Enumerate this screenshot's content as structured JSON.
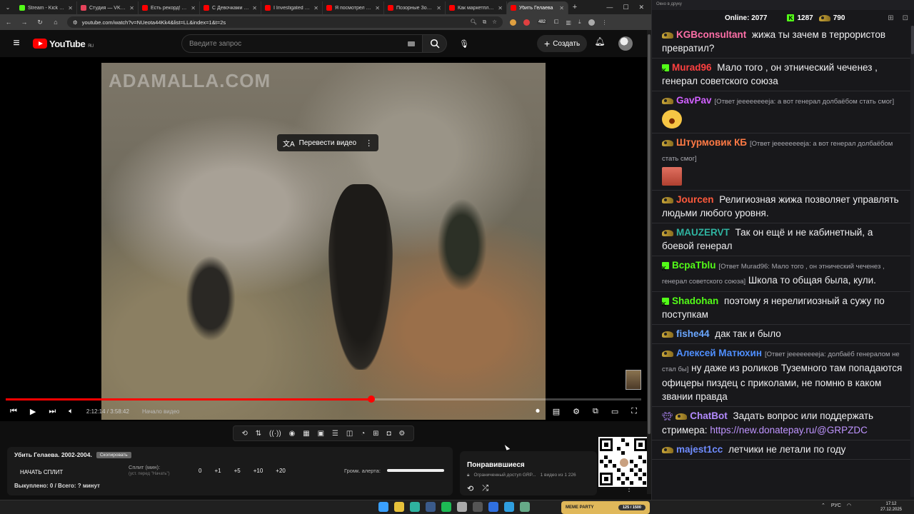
{
  "browser": {
    "tabs": [
      {
        "title": "Stream - Kick Dash",
        "color": "#53fc18"
      },
      {
        "title": "Студия — VK Видео",
        "color": "#e5435b"
      },
      {
        "title": "Есть рекорд! Пер",
        "color": "#ff0000"
      },
      {
        "title": "С Девочками Бол",
        "color": "#ff0000"
      },
      {
        "title": "I Investigated Min",
        "color": "#ff0000"
      },
      {
        "title": "Я посмотрел все ф",
        "color": "#ff0000"
      },
      {
        "title": "Позорные Зоозащ",
        "color": "#ff0000"
      },
      {
        "title": "Как маркетплейсы",
        "color": "#ff0000"
      },
      {
        "title": "Убить Гелаева",
        "color": "#ff0000",
        "active": true
      }
    ],
    "url": "youtube.com/watch?v=NUeota44Kk4&list=LL&index=1&t=2s",
    "ext_badge": "482"
  },
  "youtube": {
    "logo_text": "YouTube",
    "region": "RU",
    "search_placeholder": "Введите запрос",
    "create_label": "Создать"
  },
  "player": {
    "watermark": "ADAMALLA.COM",
    "translate_label": "Перевести видео",
    "time": "2:12:14 / 3:58:42",
    "chapter": "Начало видео",
    "progress_fraction": 0.575
  },
  "split_panel": {
    "title": "Убить Гелаева. 2002-2004.",
    "badge": "Скопировать",
    "start_label": "НАЧАТЬ СПЛИТ",
    "split_label": "Сплит (мин):",
    "split_sub": "(уст. перед \"Начать\")",
    "values": [
      "0",
      "+1",
      "+5",
      "+10",
      "+20"
    ],
    "alert_label": "Громк. алерта:",
    "status": "Выкуплено: 0 / Всего: ? минут"
  },
  "liked": {
    "title": "Понравившиеся",
    "access": "Ограниченный доступ GRP...",
    "count": "1 видео из 1 226"
  },
  "chat": {
    "topbar": "Окно в друку",
    "online_label": "Online:",
    "online_value": "2077",
    "kick_value": "1287",
    "crown_value": "790",
    "messages": [
      {
        "user": "KGBconsultant",
        "color": "#ff6fa8",
        "badge": "crown",
        "reply": "",
        "text": "жижа ты зачем в террористов превратил?"
      },
      {
        "user": "Murad96",
        "color": "#ff4040",
        "badge": "kick",
        "reply": "",
        "text": "Мало того , он этнический чеченез , генерал советского союза"
      },
      {
        "user": "GavPav",
        "color": "#d060ff",
        "badge": "crown",
        "reply": "[Ответ jeeeeeeeeja: а вот генерал долбаёбом стать смог]",
        "text": "",
        "emote": "laugh"
      },
      {
        "user": "Штурмовик КБ",
        "color": "#ff7a45",
        "badge": "crown",
        "reply": "[Ответ jeeeeeeeeja: а вот генерал долбаёбом стать смог]",
        "text": "",
        "emote": "face"
      },
      {
        "user": "Jourcen",
        "color": "#ff5a3c",
        "badge": "crown",
        "reply": "",
        "text": "Религиозная жижа позволяет управлять людьми любого уровня."
      },
      {
        "user": "MAUZERVT",
        "color": "#2fb3a0",
        "badge": "crown",
        "reply": "",
        "text": "Так он ещё и не кабинетный, а боевой генерал"
      },
      {
        "user": "BcpaTblu",
        "color": "#53fc18",
        "badge": "kick",
        "reply": "[Ответ Murad96: Мало того , он этнический чеченез , генерал советского союза]",
        "text": "Школа то общая была, кули."
      },
      {
        "user": "Shadohan",
        "color": "#53fc18",
        "badge": "kick",
        "reply": "",
        "text": "поэтому я нерелигиозный а сужу по поступкам"
      },
      {
        "user": "fishe44",
        "color": "#6aa7ff",
        "badge": "crown",
        "reply": "",
        "text": "дак так и было"
      },
      {
        "user": "Алексей Матюхин",
        "color": "#4f8fff",
        "badge": "crown",
        "reply": "[Ответ jeeeeeeeeja: долбаёб генералом не стал бы]",
        "text": "ну даже из роликов Туземного там попадаются офицеры пиздец с приколами, не помню в каком звании правда"
      },
      {
        "user": "ChatBot",
        "color": "#b38bff",
        "badge": "bot",
        "reply": "",
        "text": "Задать вопрос или поддержать стримера:",
        "link": "https://new.donatepay.ru/@GRPZDC"
      },
      {
        "user": "majest1cc",
        "color": "#6f8cff",
        "badge": "crown",
        "reply": "",
        "text": "летчики не летали по году"
      }
    ]
  },
  "taskbar": {
    "widget_label": "MEME PARTY",
    "widget_value": "125 / 1500",
    "lang": "РУС",
    "time": "17:12",
    "date": "27.12.2025"
  }
}
